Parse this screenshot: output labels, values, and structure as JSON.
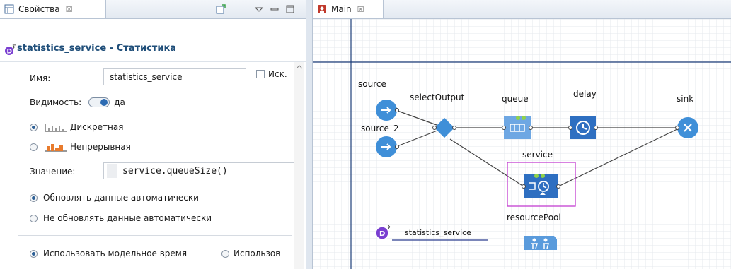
{
  "props": {
    "tab_label": "Свойства",
    "tab_close": "☒",
    "title": "statistics_service - Статистика",
    "name_label": "Имя:",
    "name_value": "statistics_service",
    "exclude_label": "Иск.",
    "visibility_label": "Видимость:",
    "visibility_value": "да",
    "discrete_label": "Дискретная",
    "continuous_label": "Непрерывная",
    "value_label": "Значение:",
    "value_expr": "service.queueSize()",
    "auto_update": "Обновлять данные автоматически",
    "no_auto_update": "Не обновлять данные автоматически",
    "model_time": "Использовать модельное время",
    "other_time": "Использов"
  },
  "main": {
    "tab_label": "Main",
    "tab_close": "☒",
    "blocks": {
      "source": "source",
      "source_2": "source_2",
      "selectOutput": "selectOutput",
      "queue": "queue",
      "delay": "delay",
      "sink": "sink",
      "service": "service",
      "resourcePool": "resourcePool",
      "statistics": "statistics_service"
    }
  },
  "colors": {
    "accent": "#2c6bb3",
    "block": "#2e6fc1",
    "block_light": "#6ea7e3",
    "selection": "#c23fd1",
    "stat": "#7a3fd1"
  }
}
